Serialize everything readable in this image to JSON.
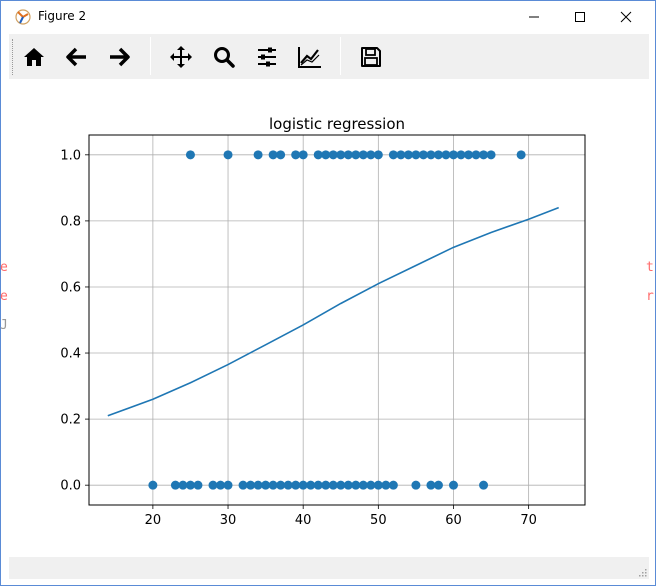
{
  "window": {
    "title": "Figure 2"
  },
  "toolbar": {
    "icons": [
      "home-icon",
      "back-arrow-icon",
      "forward-arrow-icon",
      "pan-icon",
      "zoom-icon",
      "configure-subplots-icon",
      "edit-axis-icon",
      "save-icon"
    ]
  },
  "colors": {
    "series": "#1f77b4",
    "axes": "#000000",
    "grid": "#b0b0b0",
    "toolbar": "#f0f0f0",
    "background_bleed": "#ff6b6b"
  },
  "background_bleed": {
    "left": [
      "e",
      "e",
      "J"
    ],
    "right": [
      "t",
      "r"
    ]
  },
  "chart_data": {
    "type": "scatter",
    "title": "logistic regression",
    "xlabel": "",
    "ylabel": "",
    "xlim": [
      11.5,
      77.5
    ],
    "ylim": [
      -0.06,
      1.06
    ],
    "xticks": [
      20,
      30,
      40,
      50,
      60,
      70
    ],
    "yticks": [
      0.0,
      0.2,
      0.4,
      0.6,
      0.8,
      1.0
    ],
    "grid": true,
    "series": [
      {
        "type": "scatter",
        "y": 1.0,
        "x": [
          25,
          30,
          34,
          36,
          37,
          39,
          40,
          42,
          43,
          44,
          45,
          46,
          47,
          48,
          49,
          50,
          52,
          53,
          54,
          55,
          56,
          57,
          58,
          59,
          60,
          61,
          62,
          63,
          64,
          65,
          69
        ]
      },
      {
        "type": "scatter",
        "y": 0.0,
        "x": [
          20,
          23,
          24,
          25,
          26,
          28,
          29,
          30,
          32,
          33,
          34,
          35,
          36,
          37,
          38,
          39,
          40,
          41,
          42,
          43,
          44,
          45,
          46,
          47,
          48,
          49,
          50,
          51,
          52,
          55,
          57,
          58,
          60,
          64
        ]
      },
      {
        "type": "line",
        "x": [
          14,
          20,
          25,
          30,
          35,
          40,
          45,
          50,
          55,
          60,
          65,
          70,
          74
        ],
        "y": [
          0.21,
          0.26,
          0.31,
          0.365,
          0.425,
          0.485,
          0.55,
          0.61,
          0.665,
          0.72,
          0.765,
          0.805,
          0.84
        ]
      }
    ]
  }
}
